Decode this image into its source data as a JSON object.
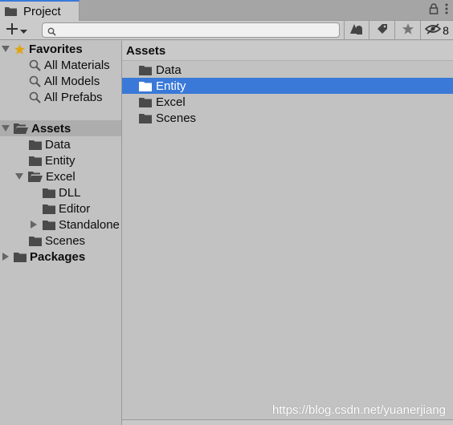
{
  "tab": {
    "title": "Project"
  },
  "toolbar": {
    "search_placeholder": "",
    "hidden_count": "8"
  },
  "favorites": {
    "label": "Favorites",
    "items": [
      {
        "label": "All Materials"
      },
      {
        "label": "All Models"
      },
      {
        "label": "All Prefabs"
      }
    ]
  },
  "tree": {
    "assets": "Assets",
    "data": "Data",
    "entity": "Entity",
    "excel": "Excel",
    "dll": "DLL",
    "editor": "Editor",
    "standalone": "Standalone",
    "scenes": "Scenes",
    "packages": "Packages"
  },
  "content": {
    "breadcrumb": "Assets",
    "items": [
      {
        "label": "Data",
        "selected": false
      },
      {
        "label": "Entity",
        "selected": true
      },
      {
        "label": "Excel",
        "selected": false
      },
      {
        "label": "Scenes",
        "selected": false
      }
    ]
  },
  "watermark": "https://blog.csdn.net/yuanerjiang",
  "colors": {
    "selection": "#3a79d8",
    "panel": "#c2c2c2",
    "folder": "#4a4a4a"
  }
}
